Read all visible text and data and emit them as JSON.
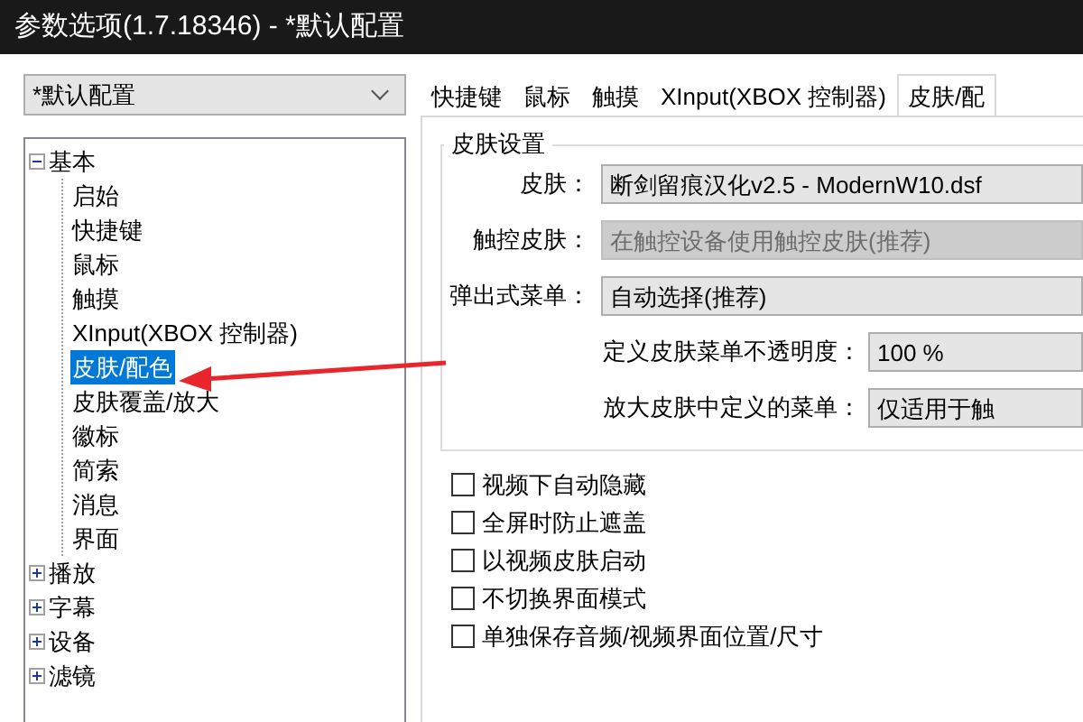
{
  "window": {
    "title": "参数选项(1.7.18346) - *默认配置"
  },
  "profile": {
    "value": "*默认配置"
  },
  "tree": [
    {
      "label": "基本",
      "expanded": true,
      "selected": false,
      "children": [
        {
          "label": "启始",
          "selected": false
        },
        {
          "label": "快捷键",
          "selected": false
        },
        {
          "label": "鼠标",
          "selected": false
        },
        {
          "label": "触摸",
          "selected": false
        },
        {
          "label": "XInput(XBOX 控制器)",
          "selected": false
        },
        {
          "label": "皮肤/配色",
          "selected": true
        },
        {
          "label": "皮肤覆盖/放大",
          "selected": false
        },
        {
          "label": "徽标",
          "selected": false
        },
        {
          "label": "简索",
          "selected": false
        },
        {
          "label": "消息",
          "selected": false
        },
        {
          "label": "界面",
          "selected": false
        }
      ]
    },
    {
      "label": "播放",
      "expanded": false,
      "selected": false
    },
    {
      "label": "字幕",
      "expanded": false,
      "selected": false
    },
    {
      "label": "设备",
      "expanded": false,
      "selected": false
    },
    {
      "label": "滤镜",
      "expanded": false,
      "selected": false
    }
  ],
  "tabs": [
    {
      "label": "快捷键",
      "selected": false
    },
    {
      "label": "鼠标",
      "selected": false
    },
    {
      "label": "触摸",
      "selected": false
    },
    {
      "label": "XInput(XBOX 控制器)",
      "selected": false
    },
    {
      "label": "皮肤/配",
      "selected": true
    }
  ],
  "group": {
    "title": "皮肤设置",
    "fields": [
      {
        "kind": "wide",
        "label": "皮肤：",
        "value": "断剑留痕汉化v2.5 - ModernW10.dsf",
        "disabled": false
      },
      {
        "kind": "wide",
        "label": "触控皮肤：",
        "value": "在触控设备使用触控皮肤(推荐)",
        "disabled": true
      },
      {
        "kind": "wide",
        "label": "弹出式菜单：",
        "value": "自动选择(推荐)",
        "disabled": false
      },
      {
        "kind": "narrow",
        "label": "定义皮肤菜单不透明度：",
        "value": "100 %",
        "disabled": false
      },
      {
        "kind": "narrow",
        "label": "放大皮肤中定义的菜单：",
        "value": "仅适用于触",
        "disabled": false
      }
    ]
  },
  "checkboxes": [
    {
      "label": "视频下自动隐藏",
      "checked": false
    },
    {
      "label": "全屏时防止遮盖",
      "checked": false
    },
    {
      "label": "以视频皮肤启动",
      "checked": false
    },
    {
      "label": "不切换界面模式",
      "checked": false
    },
    {
      "label": "单独保存音频/视频界面位置/尺寸",
      "checked": false
    }
  ]
}
